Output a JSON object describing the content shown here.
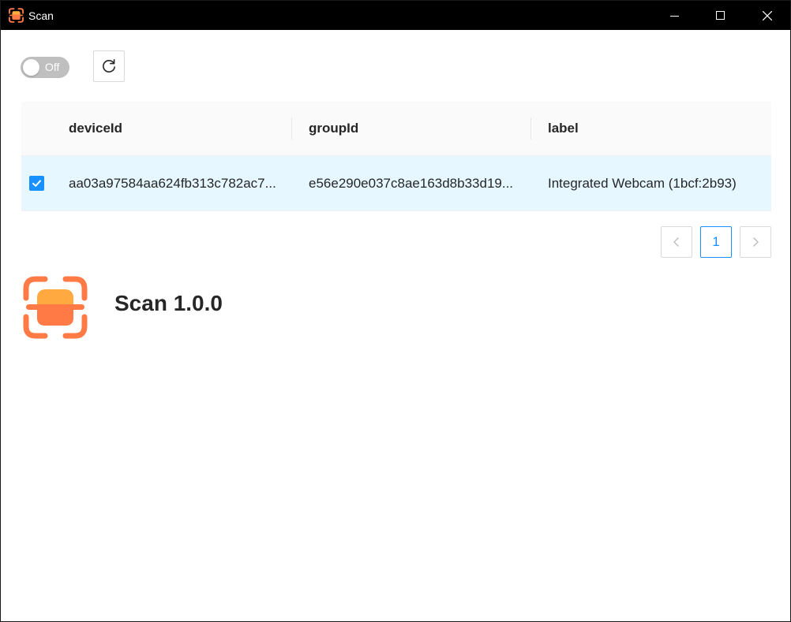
{
  "window": {
    "title": "Scan",
    "controls": [
      "minimize",
      "maximize",
      "close"
    ]
  },
  "toolbar": {
    "switch_label": "Off",
    "switch_on": false,
    "refresh_icon": "refresh-icon"
  },
  "table": {
    "columns": [
      "deviceId",
      "groupId",
      "label"
    ],
    "rows": [
      {
        "selected": true,
        "deviceId": "aa03a97584aa624fb313c782ac7...",
        "groupId": "e56e290e037c8ae163d8b33d19...",
        "label": "Integrated Webcam (1bcf:2b93)"
      }
    ]
  },
  "pagination": {
    "current_page": "1",
    "prev_icon": "chevron-left-icon",
    "next_icon": "chevron-right-icon"
  },
  "about": {
    "version_text": "Scan 1.0.0"
  },
  "colors": {
    "accent": "#1890ff",
    "selected_row": "#e6f7ff",
    "header_bg": "#fafafa",
    "logo_orange": "#ff7a45",
    "logo_light": "#ffa940",
    "titlebar": "#000000"
  }
}
